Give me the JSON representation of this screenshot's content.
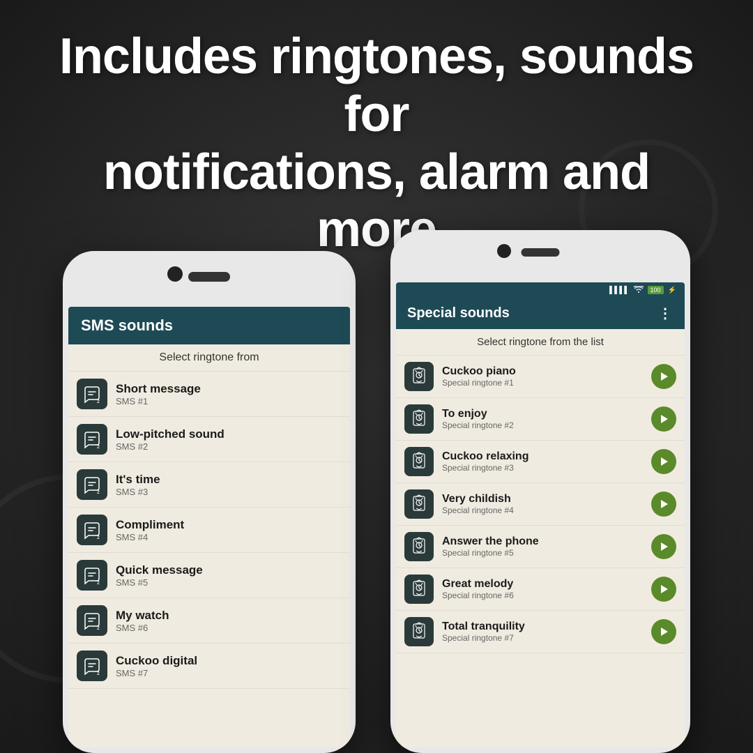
{
  "headline": {
    "line1": "Includes ringtones, sounds for",
    "line2": "notifications, alarm and more"
  },
  "phone_left": {
    "header": "SMS sounds",
    "subheader": "Select ringtone from",
    "items": [
      {
        "title": "Short message",
        "subtitle": "SMS #1"
      },
      {
        "title": "Low-pitched sound",
        "subtitle": "SMS #2"
      },
      {
        "title": "It's time",
        "subtitle": "SMS #3"
      },
      {
        "title": "Compliment",
        "subtitle": "SMS #4"
      },
      {
        "title": "Quick message",
        "subtitle": "SMS #5"
      },
      {
        "title": "My watch",
        "subtitle": "SMS #6"
      },
      {
        "title": "Cuckoo digital",
        "subtitle": "SMS #7"
      }
    ]
  },
  "phone_right": {
    "status": {
      "signal": "▌▌▌▌",
      "wifi": "WiFi",
      "battery": "100",
      "charge": "⚡"
    },
    "header": "Special sounds",
    "menu_icon": "⋮",
    "subheader": "Select ringtone from the list",
    "items": [
      {
        "title": "Cuckoo piano",
        "subtitle": "Special ringtone #1"
      },
      {
        "title": "To enjoy",
        "subtitle": "Special ringtone #2"
      },
      {
        "title": "Cuckoo relaxing",
        "subtitle": "Special ringtone #3"
      },
      {
        "title": "Very childish",
        "subtitle": "Special ringtone #4"
      },
      {
        "title": "Answer the phone",
        "subtitle": "Special ringtone #5"
      },
      {
        "title": "Great melody",
        "subtitle": "Special ringtone #6"
      },
      {
        "title": "Total tranquility",
        "subtitle": "Special ringtone #7"
      }
    ]
  },
  "colors": {
    "header_bg": "#1e4a55",
    "app_bg": "#f0ebe0",
    "icon_bg": "#2a3a3a",
    "play_btn": "#5a8a2a",
    "phone_body": "#e8e8e8"
  }
}
